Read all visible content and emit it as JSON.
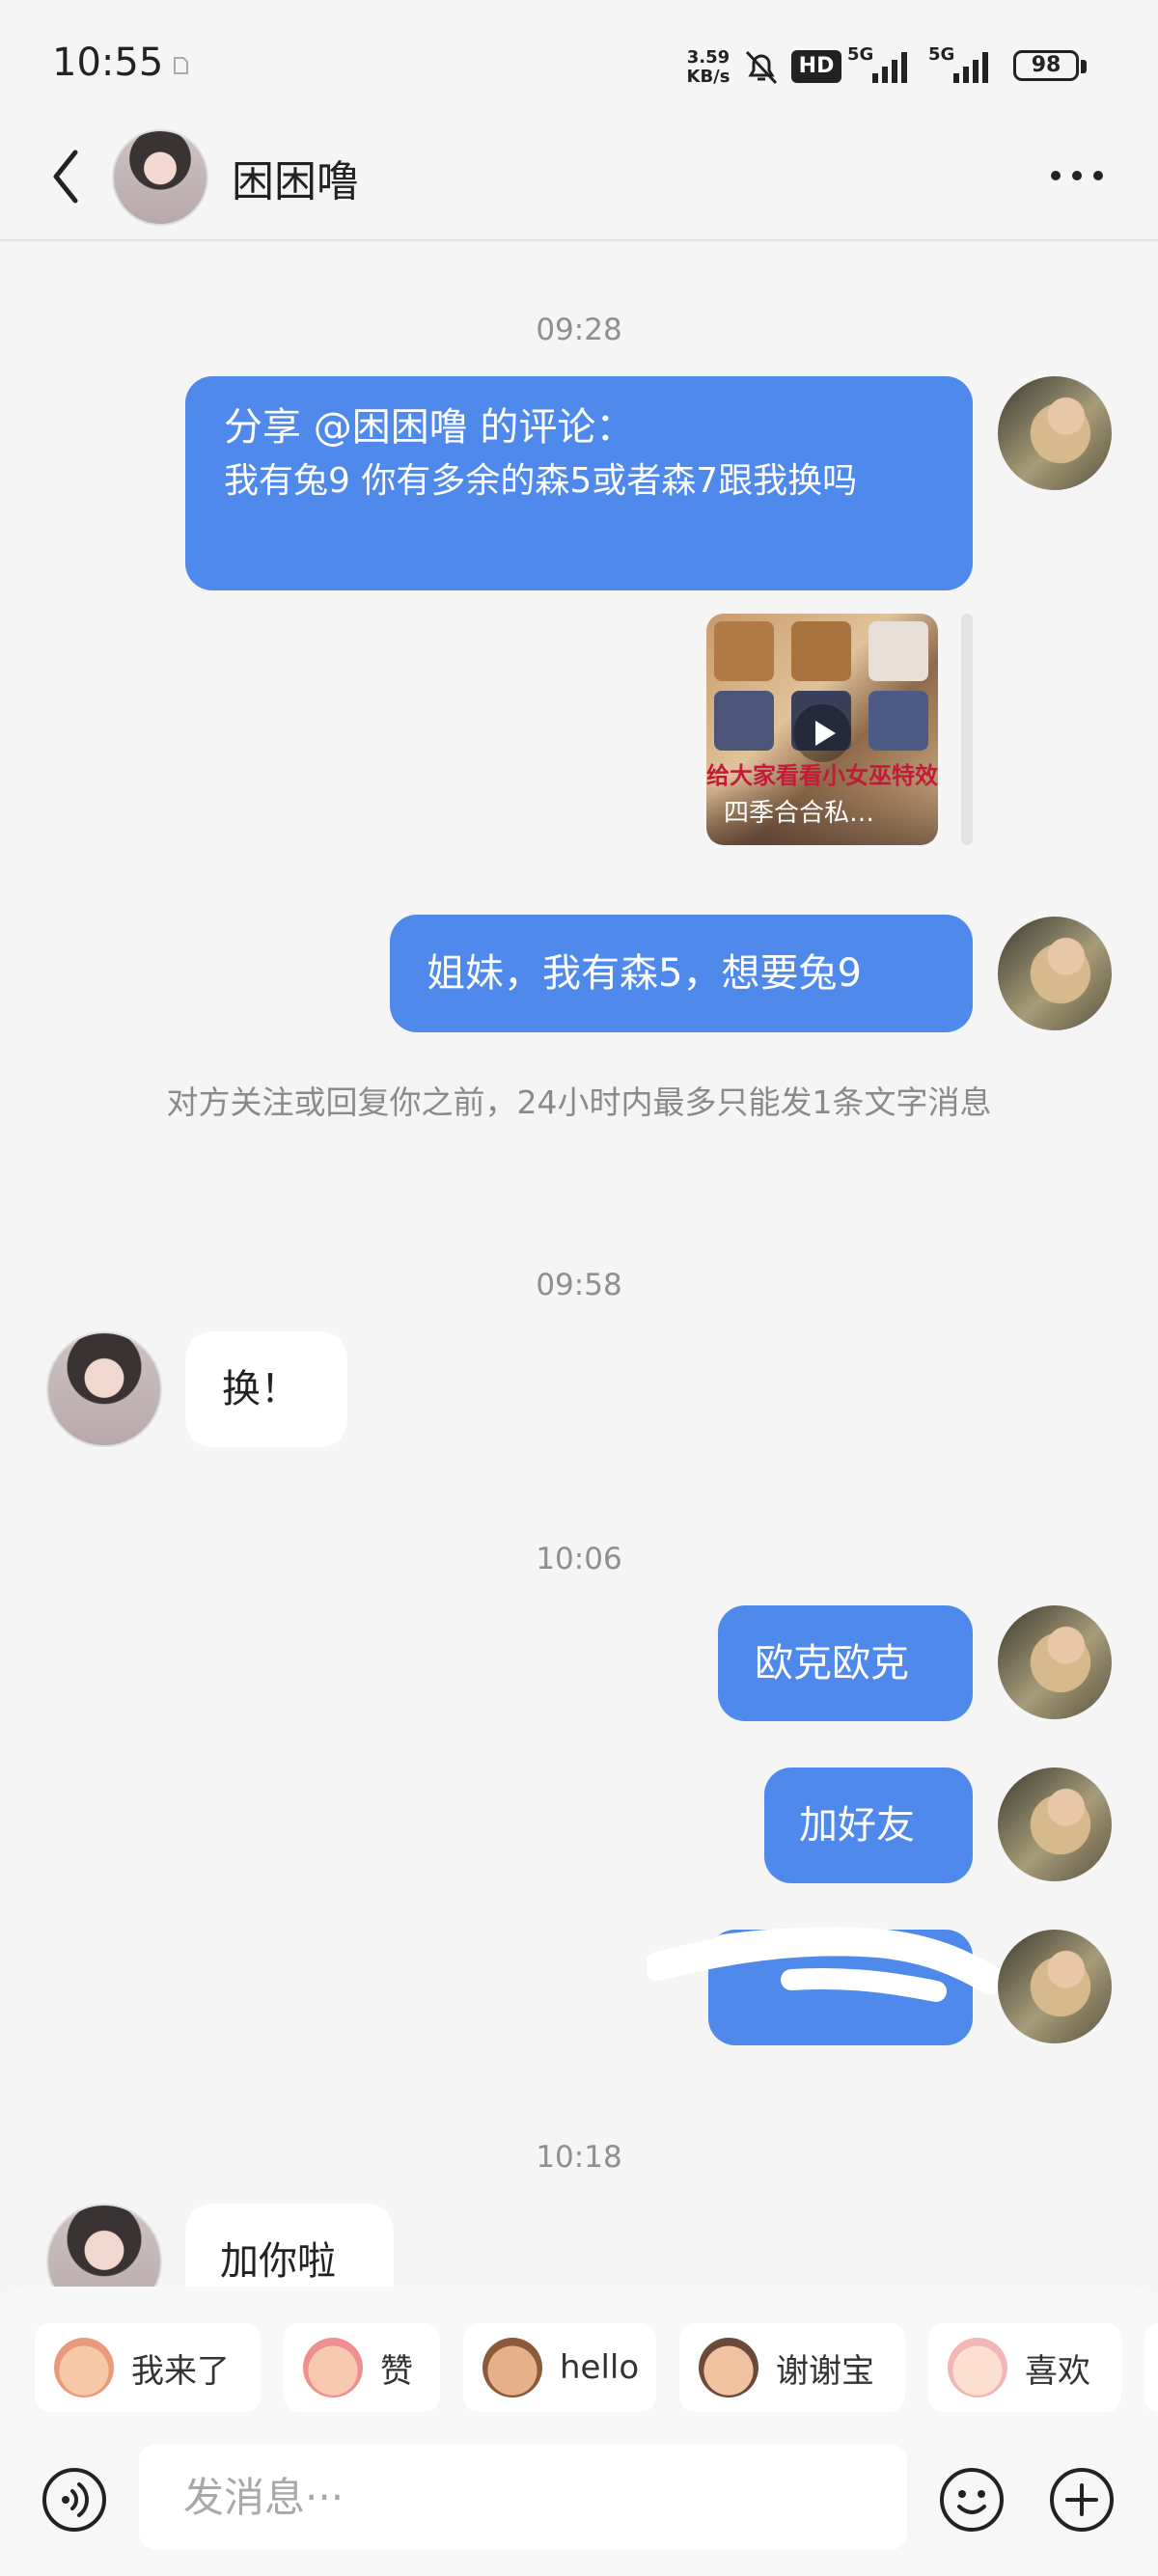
{
  "status_bar": {
    "time": "10:55",
    "net_speed_value": "3.59",
    "net_speed_unit": "KB/s",
    "hd_badge": "HD",
    "signal1_label": "5G",
    "signal2_label": "5G",
    "battery": "98"
  },
  "header": {
    "contact_name": "困困噜",
    "back_icon": "chevron-left-icon",
    "more_icon": "more-dots-icon"
  },
  "messages": {
    "time1": "09:28",
    "share_title": "分享 @困困噜 的评论：",
    "share_body": "我有兔9 你有多余的森5或者森7跟我换吗",
    "video_banner": "给大家看看小女巫特效",
    "video_title": "四季合合私…",
    "msg1": "姐妹，我有森5，想要兔9",
    "notice": "对方关注或回复你之前，24小时内最多只能发1条文字消息",
    "time2": "09:58",
    "msg2": "换！",
    "time3": "10:06",
    "msg3": "欧克欧克",
    "msg4": "加好友",
    "time4": "10:18",
    "msg5": "加你啦"
  },
  "quick_replies": [
    {
      "label": "我来了"
    },
    {
      "label": "赞"
    },
    {
      "label": "hello"
    },
    {
      "label": "谢谢宝"
    },
    {
      "label": "喜欢"
    }
  ],
  "input": {
    "placeholder": "发消息···"
  },
  "colors": {
    "bubble_me": "#4f89ec",
    "background": "#f5f5f5"
  }
}
